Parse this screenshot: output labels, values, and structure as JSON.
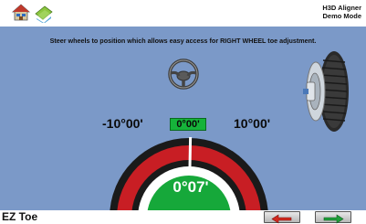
{
  "app": {
    "name_line1": "H3D Aligner",
    "name_line2": "Demo Mode"
  },
  "toolbar": {
    "buttons": [
      {
        "icon": "home-icon"
      },
      {
        "icon": "lift-icon"
      }
    ]
  },
  "instruction": "Steer wheels to position which allows easy access for RIGHT WHEEL toe adjustment.",
  "gauge": {
    "left_label": "-10°00'",
    "right_label": "10°00'",
    "current_box": "0°00'",
    "reading": "0°07'",
    "min_deg": -10,
    "max_deg": 10,
    "value_deg": 0.1167,
    "status_color": "#16b33a"
  },
  "screen_title": "EZ Toe",
  "nav": {
    "back_icon": "left-arrow-icon",
    "back_color": "#d12a1f",
    "next_icon": "right-arrow-icon",
    "next_color": "#1f9e3a"
  }
}
